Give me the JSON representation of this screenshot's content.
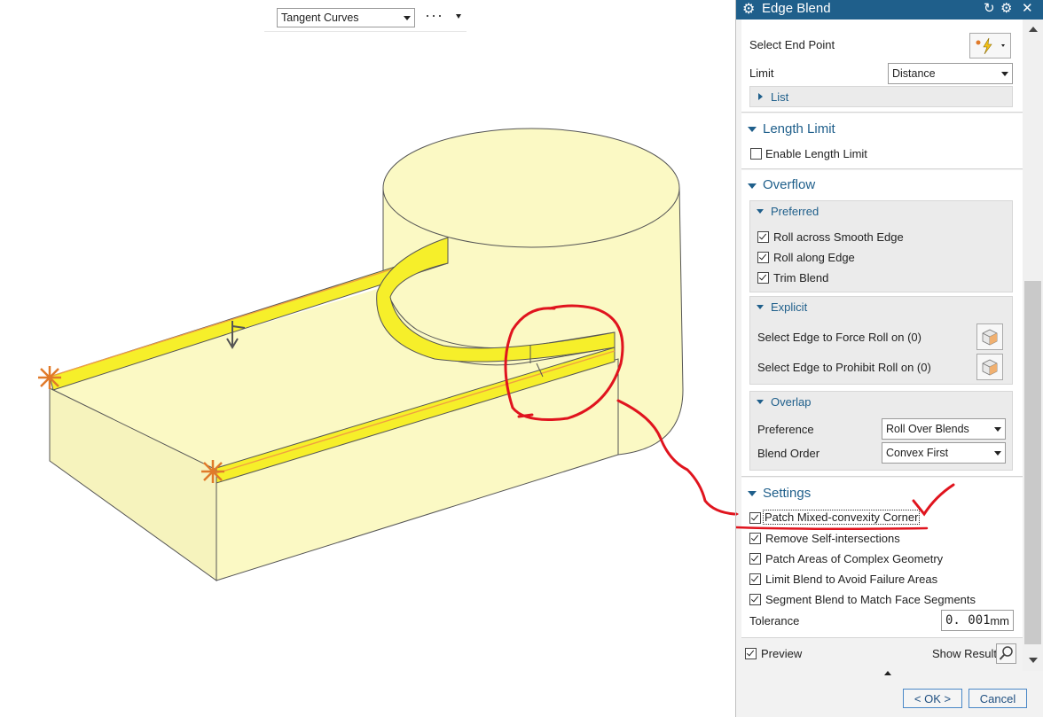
{
  "toolbar": {
    "curve_rule": "Tangent Curves",
    "more": "···"
  },
  "dialog": {
    "title": "Edge Blend",
    "select_end_point_label": "Select End Point",
    "limit_label": "Limit",
    "limit_value": "Distance",
    "list_label": "List",
    "length_limit": {
      "title": "Length Limit",
      "enable_label": "Enable Length Limit",
      "enable_checked": false
    },
    "overflow": {
      "title": "Overflow",
      "preferred": {
        "title": "Preferred",
        "items": [
          {
            "label": "Roll across Smooth Edge",
            "checked": true
          },
          {
            "label": "Roll along Edge",
            "checked": true
          },
          {
            "label": "Trim Blend",
            "checked": true
          }
        ]
      },
      "explicit": {
        "title": "Explicit",
        "force_roll_label": "Select Edge to Force Roll on (0)",
        "prohibit_roll_label": "Select Edge to Prohibit Roll on (0)"
      },
      "overlap": {
        "title": "Overlap",
        "preference_label": "Preference",
        "preference_value": "Roll Over Blends",
        "blend_order_label": "Blend Order",
        "blend_order_value": "Convex First"
      }
    },
    "settings": {
      "title": "Settings",
      "items": [
        {
          "label": "Patch Mixed-convexity Corner",
          "checked": true
        },
        {
          "label": "Remove Self-intersections",
          "checked": true
        },
        {
          "label": "Patch Areas of Complex Geometry",
          "checked": true
        },
        {
          "label": "Limit Blend to Avoid Failure Areas",
          "checked": true
        },
        {
          "label": "Segment Blend to Match Face Segments",
          "checked": true
        }
      ],
      "tolerance_label": "Tolerance",
      "tolerance_value": "0. 001",
      "tolerance_unit": "mm"
    },
    "preview_label": "Preview",
    "preview_checked": true,
    "show_result_label": "Show Result",
    "ok_label": "< OK >",
    "cancel_label": "Cancel"
  },
  "colors": {
    "accent": "#1f5f8b",
    "model_face": "#fbf9c4",
    "blend_face": "#f6ef2a",
    "annotation": "#e0141e",
    "handle": "#e07a2a"
  }
}
